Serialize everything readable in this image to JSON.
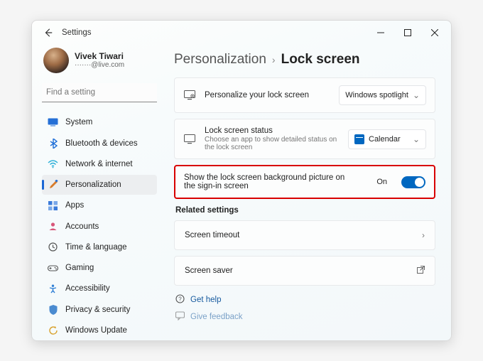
{
  "app_title": "Settings",
  "user": {
    "name": "Vivek Tiwari",
    "email": "·······@live.com"
  },
  "search": {
    "placeholder": "Find a setting"
  },
  "nav": {
    "items": [
      {
        "label": "System"
      },
      {
        "label": "Bluetooth & devices"
      },
      {
        "label": "Network & internet"
      },
      {
        "label": "Personalization"
      },
      {
        "label": "Apps"
      },
      {
        "label": "Accounts"
      },
      {
        "label": "Time & language"
      },
      {
        "label": "Gaming"
      },
      {
        "label": "Accessibility"
      },
      {
        "label": "Privacy & security"
      },
      {
        "label": "Windows Update"
      }
    ]
  },
  "breadcrumb": {
    "parent": "Personalization",
    "current": "Lock screen"
  },
  "cards": {
    "personalize": {
      "title": "Personalize your lock screen",
      "dropdown": "Windows spotlight"
    },
    "status": {
      "title": "Lock screen status",
      "sub": "Choose an app to show detailed status on the lock screen",
      "dropdown": "Calendar"
    },
    "bgpicture": {
      "title": "Show the lock screen background picture on the sign-in screen",
      "state": "On"
    }
  },
  "related": {
    "heading": "Related settings",
    "timeout": "Screen timeout",
    "saver": "Screen saver"
  },
  "help": {
    "gethelp": "Get help",
    "feedback": "Give feedback"
  }
}
